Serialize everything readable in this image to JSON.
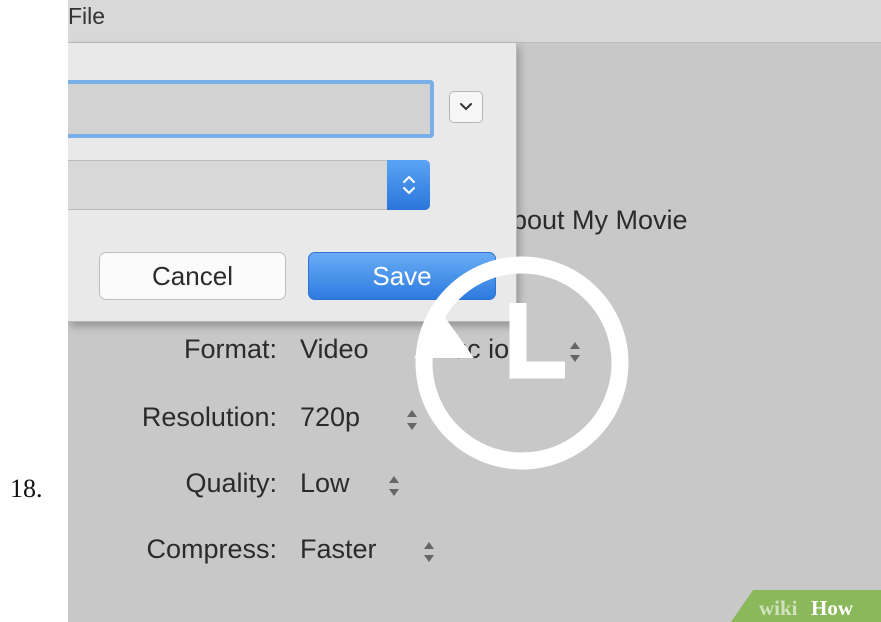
{
  "step_number": "18.",
  "menubar": {
    "file_label": "File"
  },
  "save_dialog": {
    "cancel_label": "Cancel",
    "save_label": "Save"
  },
  "export_settings": {
    "title_partial": "bout My Movie",
    "rows": [
      {
        "label": "Format:",
        "value": "Video ",
        "value_tail": "Auc io"
      },
      {
        "label": "Resolution:",
        "value": "720p"
      },
      {
        "label": "Quality:",
        "value": "Low"
      },
      {
        "label": "Compress:",
        "value": "Faster"
      }
    ]
  },
  "watermark": {
    "wiki": "wiki",
    "how": "How"
  },
  "colors": {
    "accent_blue": "#2d7be0",
    "window_gray": "#c8c8c8",
    "sheet_gray": "#e9e9e9",
    "watermark_green": "#8cb85c"
  },
  "icons": [
    "chevron-down-icon",
    "up-down-arrows-icon",
    "clock-icon",
    "arrow-up-icon"
  ]
}
